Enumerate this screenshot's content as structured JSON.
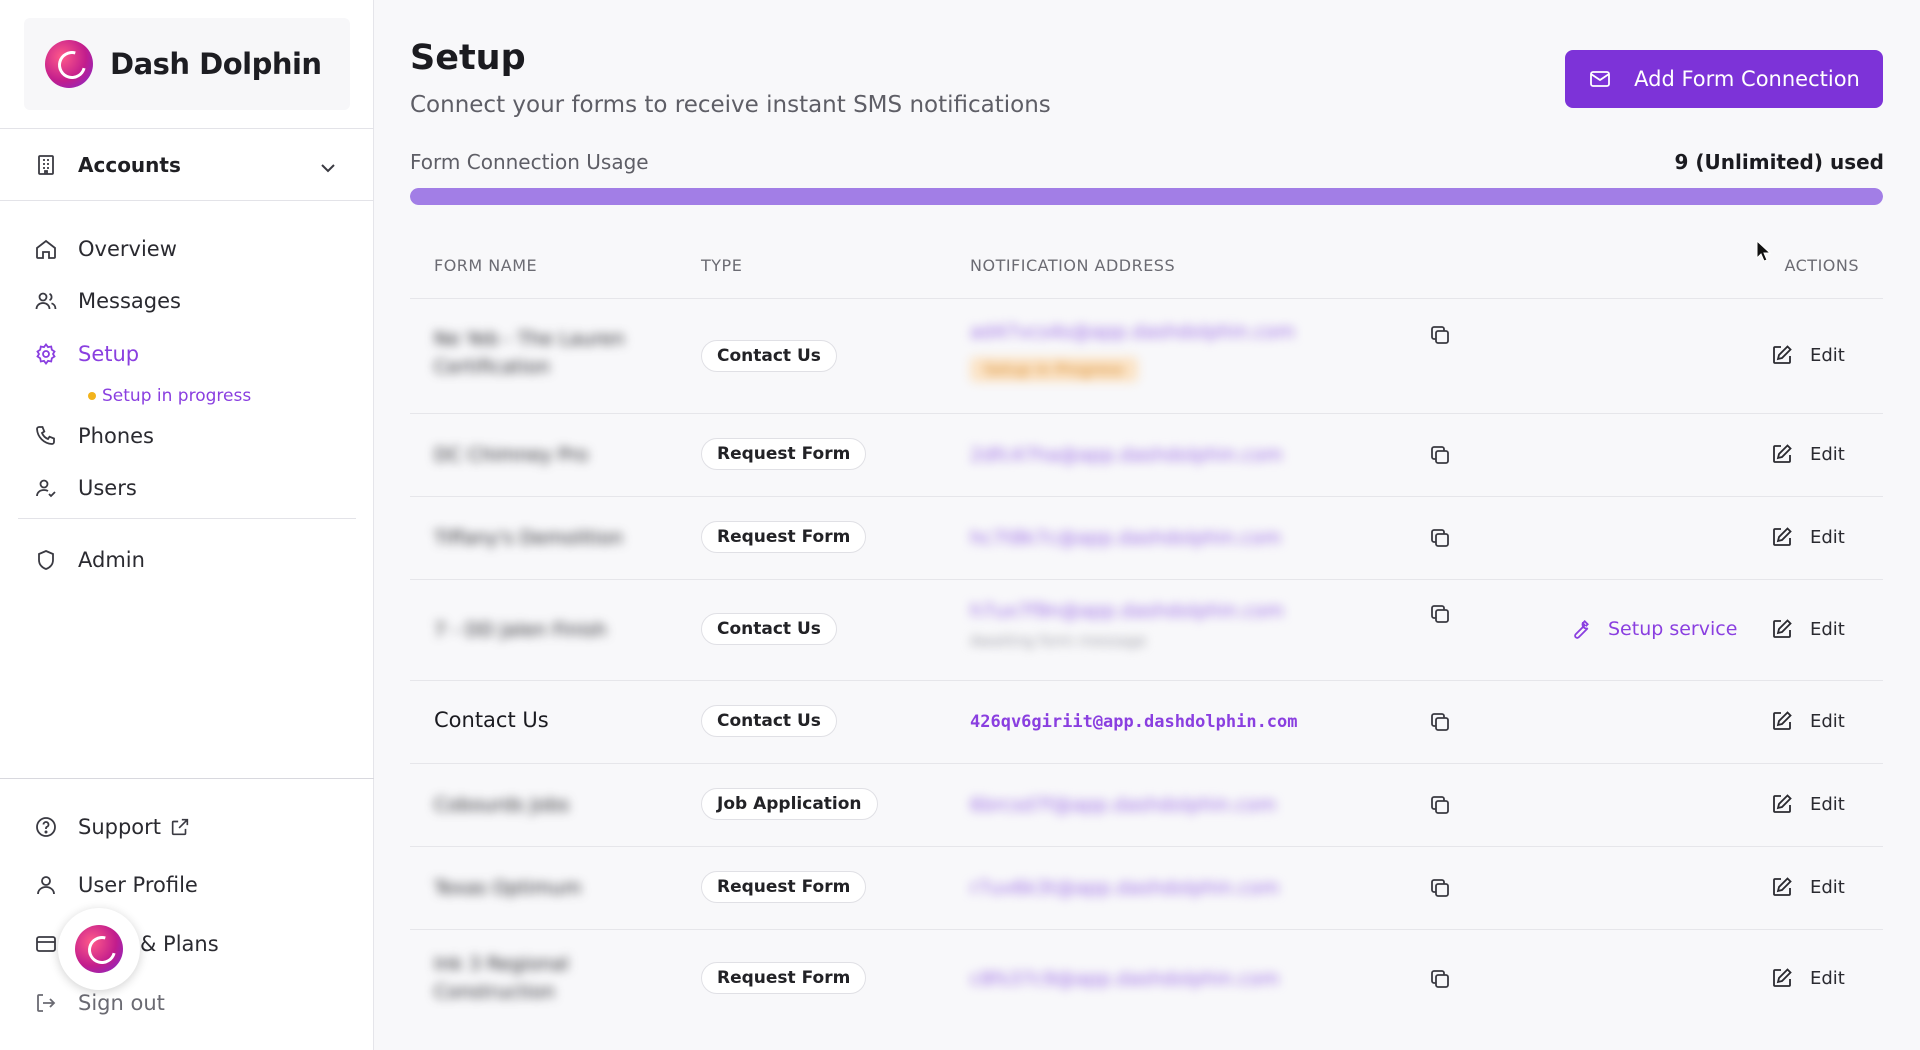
{
  "brand": {
    "name": "Dash Dolphin"
  },
  "sidebar": {
    "accounts_label": "Accounts",
    "items": [
      {
        "id": "overview",
        "label": "Overview",
        "icon": "home-icon"
      },
      {
        "id": "messages",
        "label": "Messages",
        "icon": "users-icon"
      },
      {
        "id": "setup",
        "label": "Setup",
        "icon": "gear-icon",
        "active": true
      },
      {
        "id": "phones",
        "label": "Phones",
        "icon": "phone-icon"
      },
      {
        "id": "users",
        "label": "Users",
        "icon": "user-check-icon"
      },
      {
        "id": "admin",
        "label": "Admin",
        "icon": "shield-icon"
      }
    ],
    "setup_status": "Setup in progress",
    "bottom": {
      "support": "Support",
      "profile": "User Profile",
      "plans": "& Plans",
      "signout": "Sign out"
    }
  },
  "page": {
    "title": "Setup",
    "subtitle": "Connect your forms to receive instant SMS notifications",
    "add_button": "Add Form Connection",
    "usage_label": "Form Connection Usage",
    "usage_count": "9 (Unlimited) used",
    "usage_fraction": 1.0
  },
  "table": {
    "headers": {
      "form_name": "FORM NAME",
      "type": "TYPE",
      "address": "NOTIFICATION ADDRESS",
      "actions": "ACTIONS"
    },
    "rows": [
      {
        "name": "Ne Yeb - The Lauren Certification",
        "type": "Contact Us",
        "address": "ad47vcs4s@app.dashdolphin.com",
        "tag": "Setup in Progress",
        "edit": "Edit",
        "blurred": true
      },
      {
        "name": "DC Chimney Pro",
        "type": "Request Form",
        "address": "2dfc47ha@app.dashdolphin.com",
        "edit": "Edit",
        "blurred": true
      },
      {
        "name": "Tiffany's Demolition",
        "type": "Request Form",
        "address": "hc7t8k7c@app.dashdolphin.com",
        "edit": "Edit",
        "blurred": true
      },
      {
        "name": "7 - DD Jalen Finish",
        "type": "Contact Us",
        "address": "h7ux7f9n@app.dashdolphin.com",
        "subnote": "Awaiting form message",
        "setup_service": "Setup service",
        "edit": "Edit",
        "blurred": true
      },
      {
        "name": "Contact Us",
        "type": "Contact Us",
        "address": "426qv6giriit@app.dashdolphin.com",
        "edit": "Edit",
        "blurred": false
      },
      {
        "name": "Cobourds Jobs",
        "type": "Job Application",
        "address": "6brcsd7f@app.dashdolphin.com",
        "edit": "Edit",
        "blurred": true
      },
      {
        "name": "Texas Optimum",
        "type": "Request Form",
        "address": "r7uv6k3t@app.dashdolphin.com",
        "edit": "Edit",
        "blurred": true
      },
      {
        "name": "Ink 3 Regional Construction",
        "type": "Request Form",
        "address": "c8fs37c9@app.dashdolphin.com",
        "edit": "Edit",
        "blurred": true
      }
    ]
  },
  "colors": {
    "accent": "#7d33d8",
    "status_dot": "#f2b31b"
  }
}
